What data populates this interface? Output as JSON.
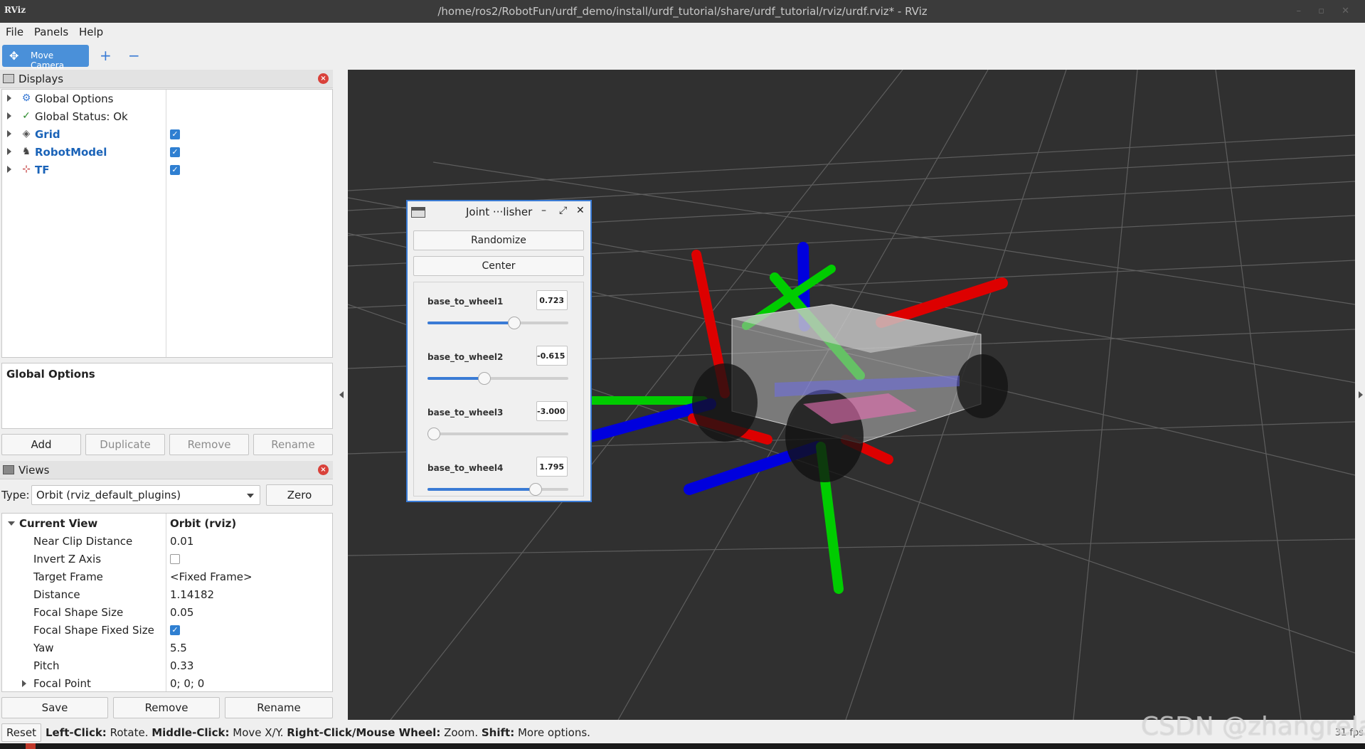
{
  "window": {
    "app_logo": "RViz",
    "title": "/home/ros2/RobotFun/urdf_demo/install/urdf_tutorial/share/urdf_tutorial/rviz/urdf.rviz* - RViz"
  },
  "menu": [
    "File",
    "Panels",
    "Help"
  ],
  "toolbar": {
    "move_camera": "Move Camera",
    "plus_icon": "+",
    "minus_icon": "−"
  },
  "displays": {
    "title": "Displays",
    "items": [
      {
        "label": "Global Options",
        "icon": "gear-icon",
        "checked": null
      },
      {
        "label": "Global Status: Ok",
        "icon": "checkmark-icon",
        "checked": null
      },
      {
        "label": "Grid",
        "icon": "grid-icon",
        "checked": true
      },
      {
        "label": "RobotModel",
        "icon": "robot-icon",
        "checked": true
      },
      {
        "label": "TF",
        "icon": "axes-icon",
        "checked": true
      }
    ],
    "description": "Global Options",
    "buttons": {
      "add": "Add",
      "duplicate": "Duplicate",
      "remove": "Remove",
      "rename": "Rename"
    }
  },
  "views": {
    "title": "Views",
    "type_label": "Type:",
    "type_value": "Orbit (rviz_default_plugins)",
    "zero": "Zero",
    "current_view": {
      "key": "Current View",
      "value": "Orbit (rviz)"
    },
    "properties": [
      {
        "key": "Near Clip Distance",
        "value": "0.01"
      },
      {
        "key": "Invert Z Axis",
        "value": "",
        "checkbox": false
      },
      {
        "key": "Target Frame",
        "value": "<Fixed Frame>"
      },
      {
        "key": "Distance",
        "value": "1.14182"
      },
      {
        "key": "Focal Shape Size",
        "value": "0.05"
      },
      {
        "key": "Focal Shape Fixed Size",
        "value": "",
        "checkbox": true
      },
      {
        "key": "Yaw",
        "value": "5.5"
      },
      {
        "key": "Pitch",
        "value": "0.33"
      },
      {
        "key": "Focal Point",
        "value": "0; 0; 0"
      }
    ],
    "buttons": {
      "save": "Save",
      "remove": "Remove",
      "rename": "Rename"
    }
  },
  "joint_publisher": {
    "title": "Joint ···lisher",
    "randomize": "Randomize",
    "center": "Center",
    "joints": [
      {
        "name": "base_to_wheel1",
        "value": "0.723",
        "fraction": 0.615
      },
      {
        "name": "base_to_wheel2",
        "value": "-0.615",
        "fraction": 0.402
      },
      {
        "name": "base_to_wheel3",
        "value": "-3.000",
        "fraction": 0.045
      },
      {
        "name": "base_to_wheel4",
        "value": "1.795",
        "fraction": 0.77
      }
    ]
  },
  "statusbar": {
    "reset": "Reset",
    "hint_parts": [
      {
        "b": "Left-Click:",
        "t": " Rotate. "
      },
      {
        "b": "Middle-Click:",
        "t": " Move X/Y. "
      },
      {
        "b": "Right-Click/Mouse Wheel:",
        "t": " Zoom. "
      },
      {
        "b": "Shift:",
        "t": " More options."
      }
    ],
    "fps": "31 fps",
    "watermark": "CSDN @zhangrelay"
  },
  "colors": {
    "accent": "#3a7bd5",
    "viewport_bg": "#303030",
    "axis_x": "#ff0000",
    "axis_y": "#00cc00",
    "axis_z": "#0000ff"
  }
}
